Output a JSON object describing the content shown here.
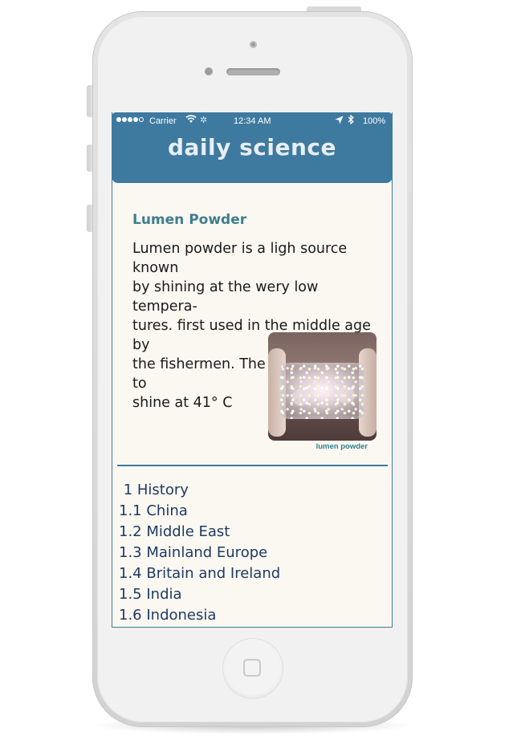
{
  "status_bar": {
    "carrier": "Carrier",
    "time": "12:34 AM",
    "battery": "100%",
    "wifi_icon": "wifi-icon",
    "activity_icon": "spinner-icon",
    "location_icon": "location-arrow-icon",
    "bluetooth_icon": "bluetooth-icon",
    "signal_dots_filled": 4,
    "signal_dots_total": 5
  },
  "header": {
    "title": "daily science"
  },
  "article": {
    "heading": "Lumen Powder",
    "lines": [
      "Lumen powder is a ligh source known",
      "by shining at the wery low tempera-",
      "tures. first used in the middle age by",
      "the fishermen. The powder starts to",
      "shine at 41° C"
    ],
    "image_caption": "lumen powder"
  },
  "toc": {
    "items": [
      " 1 History",
      "1.1 China",
      "1.2 Middle East",
      "1.3 Mainland Europe",
      "1.4 Britain and Ireland",
      "1.5 India",
      "1.6 Indonesia"
    ]
  },
  "colors": {
    "header_bg": "#3e7aa0",
    "heading": "#3f7d8e",
    "toc_text": "#1f3a64",
    "screen_bg": "#faf8f1"
  }
}
